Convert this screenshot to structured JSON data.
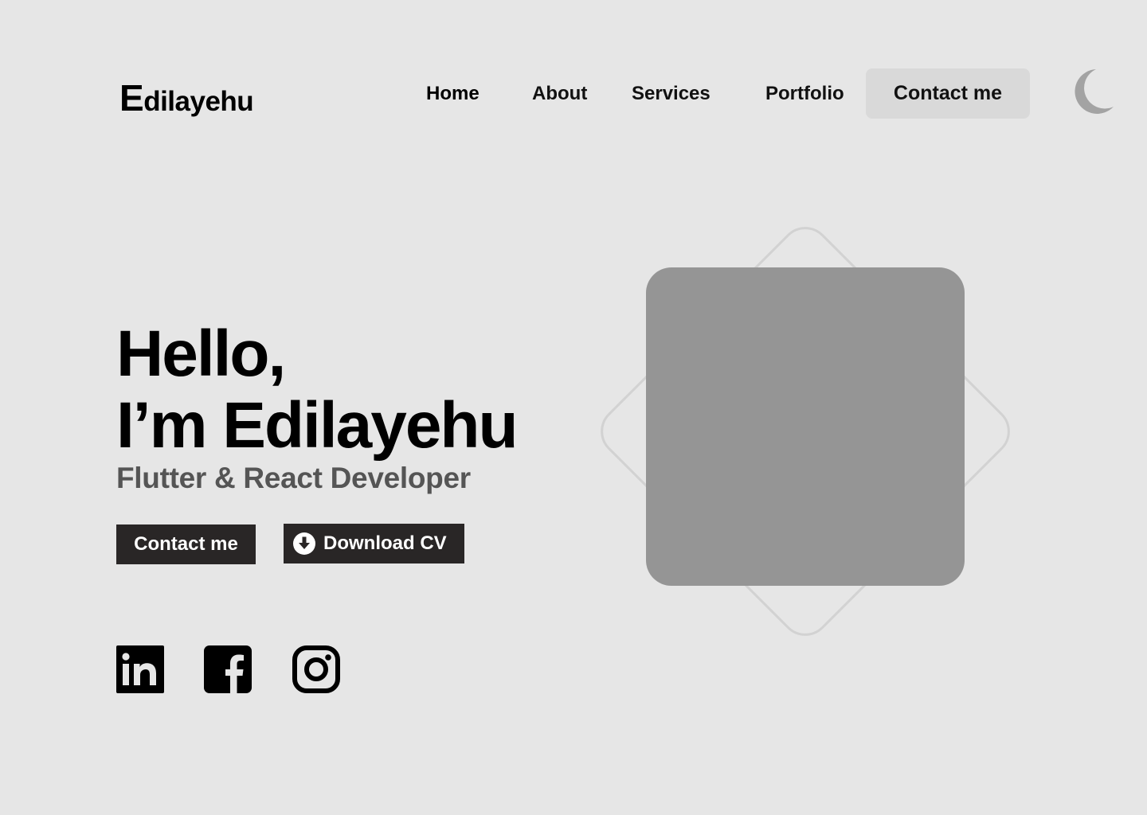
{
  "header": {
    "logo_initial": "E",
    "logo_rest": "dilayehu",
    "nav": {
      "home": "Home",
      "about": "About",
      "services": "Services",
      "portfolio": "Portfolio"
    },
    "contact_label": "Contact me",
    "theme_toggle_icon": "moon-icon"
  },
  "hero": {
    "greeting": "Hello,",
    "name_line": "I’m Edilayehu",
    "role": "Flutter & React Developer",
    "contact_button": "Contact me",
    "download_button": "Download CV",
    "download_icon": "download-circle-icon"
  },
  "social": [
    {
      "icon": "linkedin-icon"
    },
    {
      "icon": "facebook-icon"
    },
    {
      "icon": "instagram-icon"
    }
  ],
  "colors": {
    "background": "#e6e6e6",
    "button_dark": "#292626",
    "nav_button_bg": "#d9d9d9",
    "photo_placeholder": "#959595",
    "subtitle": "#555555",
    "moon": "#a3a3a3"
  }
}
